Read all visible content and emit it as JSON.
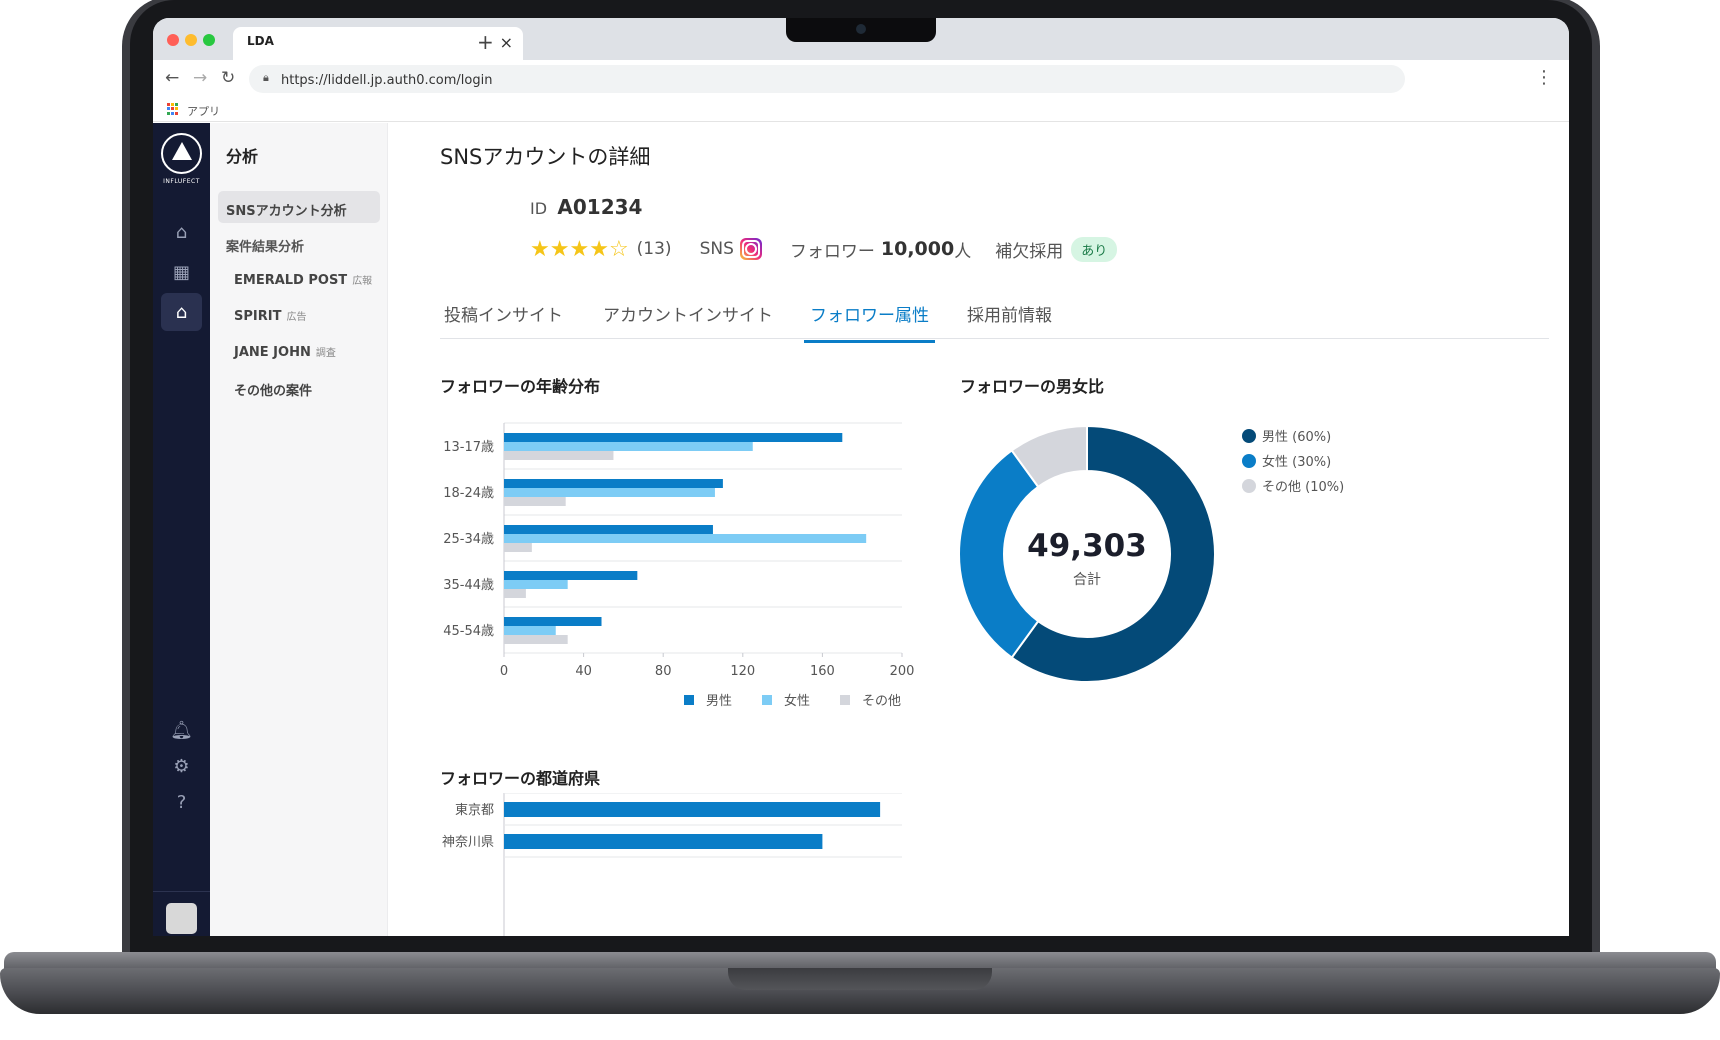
{
  "browser": {
    "tab_logo": "LDA",
    "tab_close": "×",
    "new_tab": "+",
    "url": "https://liddell.jp.auth0.com/login",
    "bookmark_apps": "アプリ"
  },
  "rail": {
    "brand": "INFLUFECT"
  },
  "sidebar": {
    "title": "分析",
    "items": [
      {
        "label": "SNSアカウント分析"
      },
      {
        "label": "案件結果分析"
      }
    ],
    "subitems": [
      {
        "label": "EMERALD POST",
        "tag": "広報"
      },
      {
        "label": "SPIRIT",
        "tag": "広告"
      },
      {
        "label": "JANE JOHN",
        "tag": "調査"
      },
      {
        "label": "その他の案件",
        "tag": ""
      }
    ]
  },
  "account": {
    "page_title": "SNSアカウントの詳細",
    "id_label": "ID",
    "id_value": "A01234",
    "rating_filled": 4,
    "rating_max": 5,
    "review_count": "(13)",
    "sns_label": "SNS",
    "sns_icon": "instagram-icon",
    "followers_label": "フォロワー",
    "followers_value": "10,000",
    "followers_unit": "人",
    "hoketsu_label": "補欠採用",
    "hoketsu_badge": "あり"
  },
  "tabs": [
    {
      "label": "投稿インサイト",
      "active": false
    },
    {
      "label": "アカウントインサイト",
      "active": false
    },
    {
      "label": "フォロワー属性",
      "active": true
    },
    {
      "label": "採用前情報",
      "active": false
    }
  ],
  "sections": {
    "age_title": "フォロワーの年齢分布",
    "gender_title": "フォロワーの男女比",
    "pref_title": "フォロワーの都道府県"
  },
  "colors": {
    "male": "#0a7dc7",
    "female": "#7dccf5",
    "other": "#d4d6dc",
    "donut_male": "#044a78",
    "donut_female": "#0a7dc7",
    "donut_other": "#d4d6dc"
  },
  "chart_data": [
    {
      "type": "bar",
      "orientation": "horizontal",
      "categories": [
        "13-17歳",
        "18-24歳",
        "25-34歳",
        "35-44歳",
        "45-54歳"
      ],
      "series": [
        {
          "name": "男性",
          "values": [
            170,
            110,
            105,
            67,
            49
          ]
        },
        {
          "name": "女性",
          "values": [
            125,
            106,
            182,
            32,
            26
          ]
        },
        {
          "name": "その他",
          "values": [
            55,
            31,
            14,
            11,
            32
          ]
        }
      ],
      "xlim": [
        0,
        200
      ],
      "xticks": [
        "0",
        "40",
        "80",
        "120",
        "160",
        "200"
      ],
      "legend": "bottom"
    },
    {
      "type": "pie",
      "variant": "donut",
      "labels": [
        "男性 (60%)",
        "女性 (30%)",
        "その他 (10%)"
      ],
      "values": [
        60,
        30,
        10
      ],
      "center_value": "49,303",
      "center_label": "合計",
      "legend": "right"
    },
    {
      "type": "bar",
      "orientation": "horizontal",
      "categories": [
        "東京都",
        "神奈川県"
      ],
      "values": [
        189,
        160
      ],
      "xlim": [
        0,
        200
      ]
    }
  ]
}
